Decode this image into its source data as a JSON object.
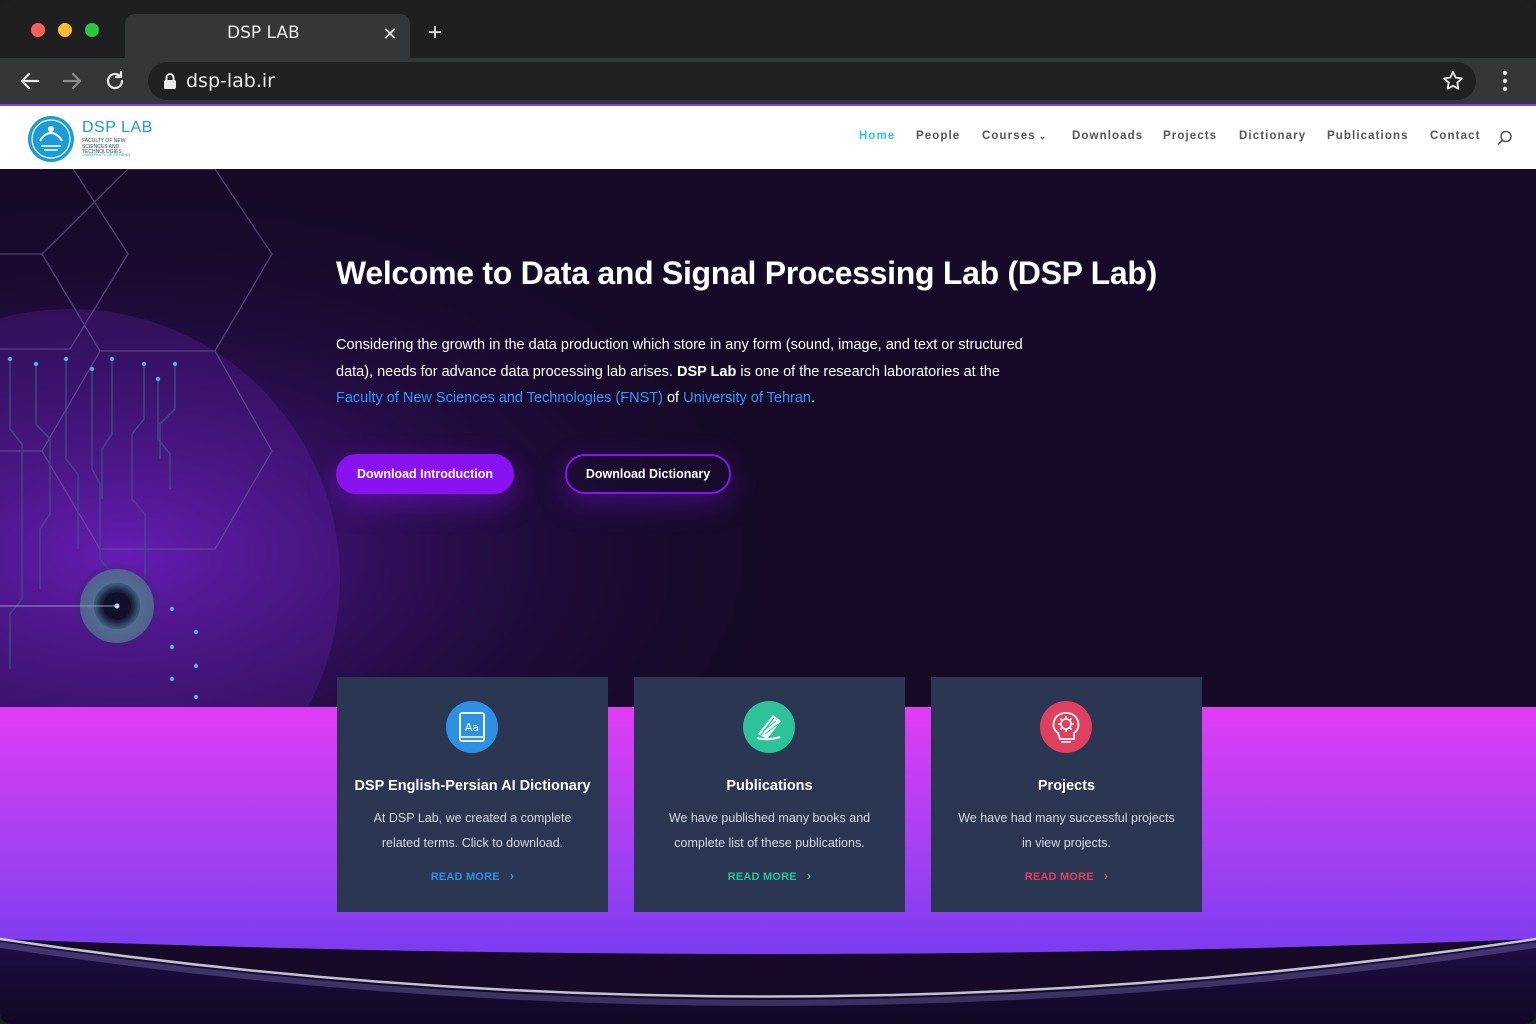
{
  "browser": {
    "tab_title": "DSP LAB",
    "url": "dsp-lab.ir",
    "icons": [
      "back-icon",
      "forward-icon",
      "reload-icon",
      "lock-icon",
      "star-icon",
      "menu-dots-icon",
      "close-icon",
      "plus-icon"
    ]
  },
  "site": {
    "logo_title": "DSP LAB",
    "logo_sub": "FACULTY OF NEW SCIENCES AND TECHNOLOGIES",
    "logo_sub2": "UNIVERSITY OF TEHRAN",
    "nav": [
      "Home",
      "People",
      "Courses",
      "Downloads",
      "Projects",
      "Dictionary",
      "Publications",
      "Contact"
    ],
    "active_nav": "Home"
  },
  "hero": {
    "title": "Welcome to Data and Signal Processing Lab (DSP Lab)",
    "text_1": "Considering the growth in the data production which store in any form (sound, image, and text or structured data), needs for advance data processing lab arises.",
    "text_bold": "DSP Lab",
    "text_2": "is one of the research laboratories at the",
    "link_faculty": "Faculty of New Sciences and Technologies (FNST)",
    "text_3": "of",
    "link_university": "University of Tehran",
    "text_4": ".",
    "btn_primary": "Download Introduction",
    "btn_secondary": "Download Dictionary"
  },
  "cards": [
    {
      "title": "DSP English-Persian AI Dictionary",
      "text": "At DSP Lab, we created a complete related terms. Click to download.",
      "link": "READ MORE",
      "color": "#2f8fe0",
      "icon": "dictionary-icon"
    },
    {
      "title": "Publications",
      "text": "We have published many books and complete list of these publications.",
      "link": "READ MORE",
      "color": "#2ec29a",
      "icon": "book-icon"
    },
    {
      "title": "Projects",
      "text": "We have had many successful projects in view projects.",
      "link": "READ MORE",
      "color": "#e0405f",
      "icon": "brain-gear-icon"
    }
  ],
  "colors": {
    "accent_purple": "#8a12f0",
    "nav_active": "#2ec3e6",
    "link_blue": "#2a96ff",
    "hero_bg": "#160a28",
    "card_bg": "#2b3652"
  }
}
